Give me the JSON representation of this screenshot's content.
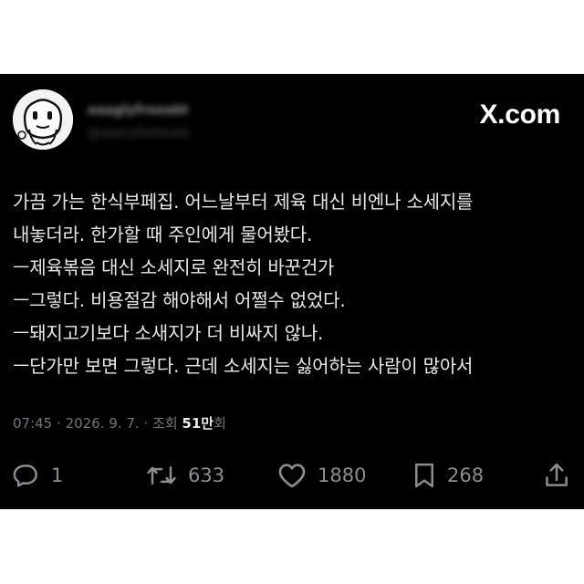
{
  "post": {
    "user": {
      "display_name": "aaaglyfreeabt",
      "handle": "@aaaryfarbeats"
    },
    "brand": "X.com",
    "body_lines": [
      "가끔 가는 한식부페집. 어느날부터 제육 대신 비엔나 소세지를",
      "내놓더라. 한가할 때 주인에게 물어봤다.",
      "ㅡ제육볶음 대신 소세지로 완전히 바꾼건가",
      "ㅡ그렇다. 비용절감 해야해서 어쩔수 없었다.",
      "ㅡ돼지고기보다 소새지가 더 비싸지 않나.",
      "ㅡ단가만 보면 그렇다. 근데 소세지는 싫어하는 사람이 많아서"
    ],
    "meta": {
      "time": "07:45",
      "separator": "·",
      "date": "2026. 9. 7.",
      "views_label": "조회",
      "views_value": "51만",
      "views_suffix": "회"
    },
    "actions": [
      {
        "icon": "reply-icon",
        "count": "1"
      },
      {
        "icon": "repost-icon",
        "count": "633"
      },
      {
        "icon": "like-icon",
        "count": "1880"
      },
      {
        "icon": "bookmark-icon",
        "count": "268"
      },
      {
        "icon": "share-icon",
        "count": ""
      }
    ]
  },
  "colors": {
    "background": "#000000",
    "text": "#e7e9ea",
    "muted": "#71767b",
    "icon": "#8a8d91"
  }
}
